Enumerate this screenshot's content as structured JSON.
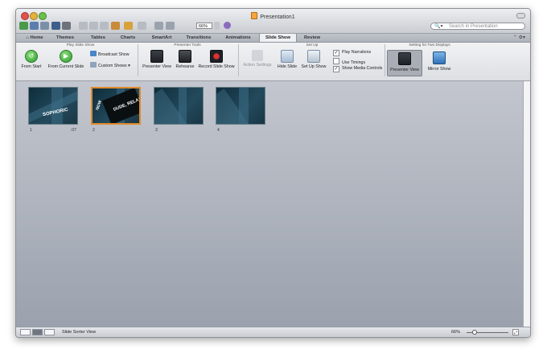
{
  "window": {
    "title": "Presentation1"
  },
  "toolbar": {
    "zoom": "66%",
    "search_placeholder": "Search in Presentation"
  },
  "tabs": [
    {
      "label": "Home",
      "icon": "home-icon"
    },
    {
      "label": "Themes"
    },
    {
      "label": "Tables"
    },
    {
      "label": "Charts"
    },
    {
      "label": "SmartArt"
    },
    {
      "label": "Transitions"
    },
    {
      "label": "Animations"
    },
    {
      "label": "Slide Show",
      "active": true
    },
    {
      "label": "Review"
    }
  ],
  "ribbon": {
    "groups": {
      "play": "Play Slide Show",
      "presenter": "Presenter Tools",
      "setup": "Set Up",
      "displays": "Setting for Two Displays"
    },
    "play": {
      "from_start": "From Start",
      "from_current": "From Current Slide",
      "broadcast": "Broadcast Show",
      "custom": "Custom Shows"
    },
    "presenter": {
      "presenter_view": "Presenter View",
      "rehearse": "Rehearse",
      "record": "Record Slide Show"
    },
    "setup": {
      "action_settings": "Action Settings",
      "hide_slide": "Hide Slide",
      "setup_show": "Set Up Show",
      "play_narrations": "Play Narrations",
      "use_timings": "Use Timings",
      "show_media_controls": "Show Media Controls"
    },
    "displays": {
      "presenter_view": "Presenter View",
      "mirror_show": "Mirror Show"
    }
  },
  "slides": [
    {
      "number": "1",
      "duration": ":07",
      "text": "SOPHORIC"
    },
    {
      "number": "2",
      "text": "DUDE, RELAX",
      "side_text": "NOW"
    },
    {
      "number": "3"
    },
    {
      "number": "4"
    }
  ],
  "status": {
    "view_label": "Slide Sorter View",
    "zoom": "66%"
  },
  "colors": {
    "selection": "#e08a2a",
    "ribbon_bg": "#e6e8eb",
    "sorter_bg": "#aab0bb"
  }
}
